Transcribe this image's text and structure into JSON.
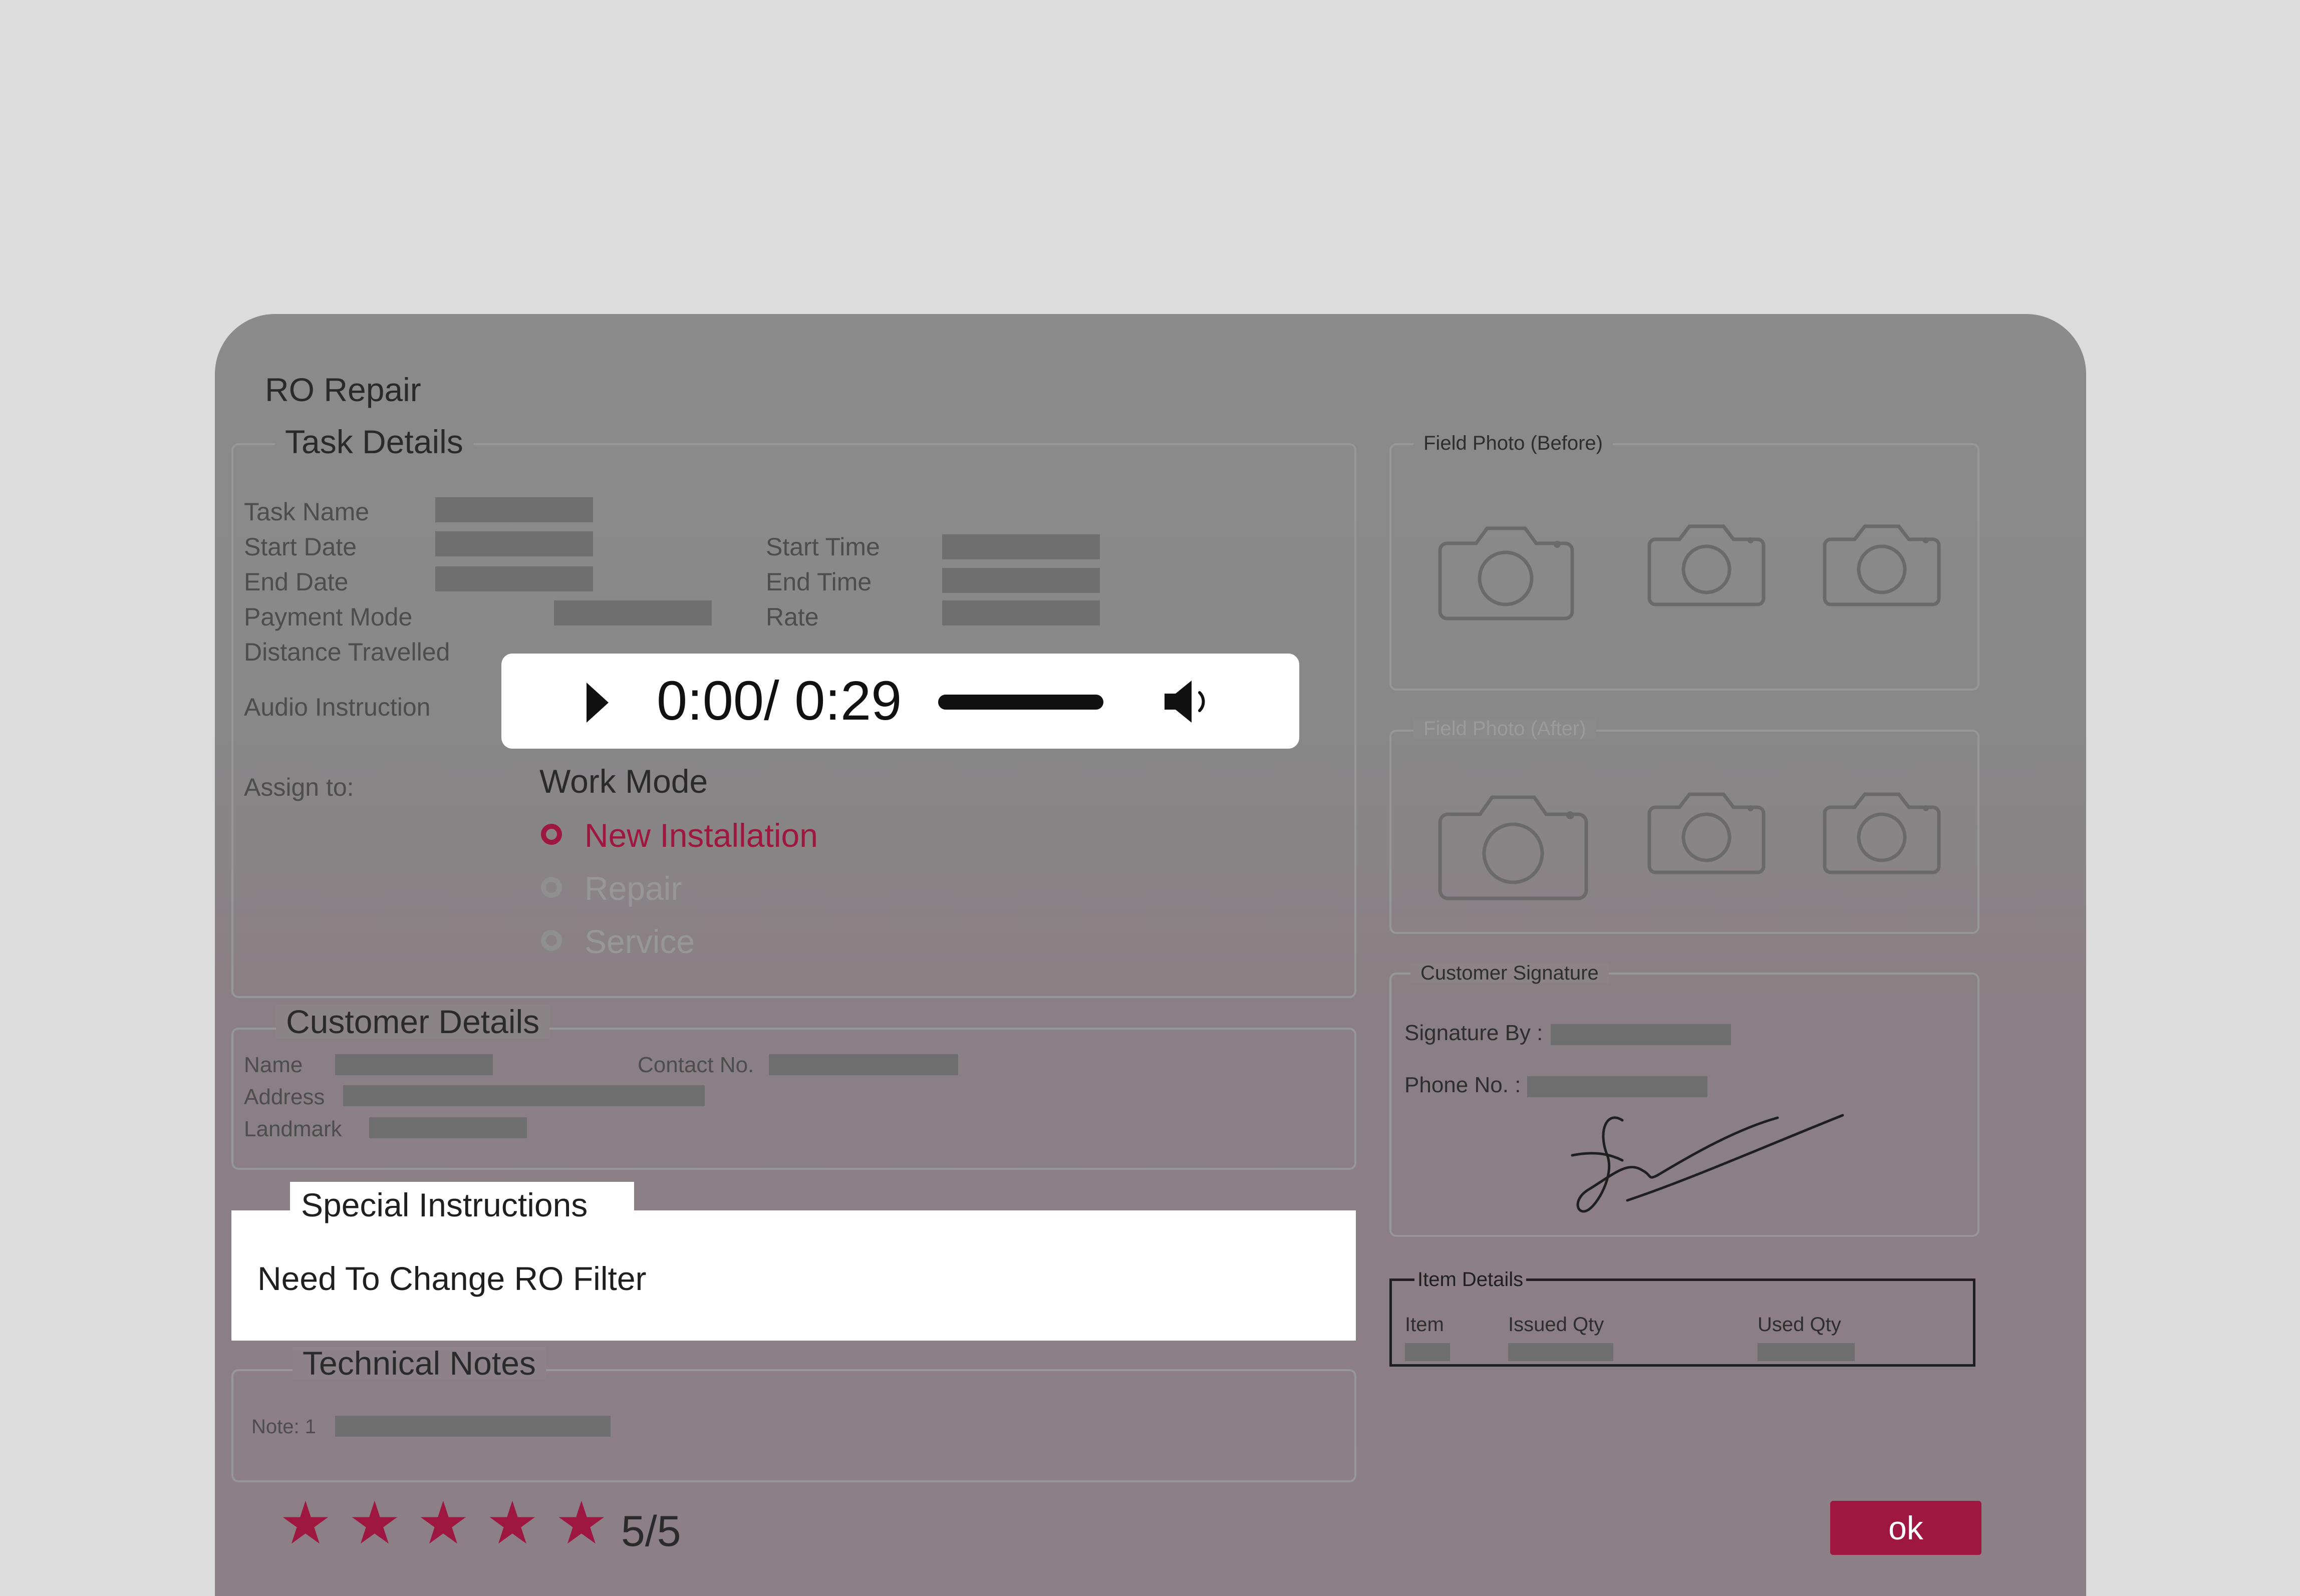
{
  "page": {
    "title": "RO Repair"
  },
  "task_details": {
    "legend": "Task Details",
    "task_name": "Task Name",
    "start_date": "Start Date",
    "end_date": "End Date",
    "payment_mode": "Payment Mode",
    "distance_travelled": "Distance Travelled",
    "start_time": "Start Time",
    "end_time": "End Time",
    "rate": "Rate",
    "audio_instruction": "Audio Instruction",
    "assign_to": "Assign to:"
  },
  "audio_player": {
    "time": "0:00/ 0:29",
    "play_icon": "play-icon",
    "volume_icon": "volume-icon"
  },
  "work_mode": {
    "label": "Work Mode",
    "options": [
      "New Installation",
      "Repair",
      "Service"
    ],
    "selected": "New Installation"
  },
  "customer_details": {
    "legend": "Customer Details",
    "name": "Name",
    "address": "Address",
    "landmark": "Landmark",
    "contact": "Contact No."
  },
  "special_instructions": {
    "legend": "Special Instructions",
    "text": "Need To Change RO Filter"
  },
  "technical_notes": {
    "legend": "Technical Notes",
    "note": "Note: 1"
  },
  "rating": {
    "stars": 5,
    "label": "5/5"
  },
  "photos": {
    "before_legend": "Field Photo (Before)",
    "after_legend": "Field Photo (After)"
  },
  "signature": {
    "legend": "Customer Signature",
    "by": "Signature By :",
    "phone": "Phone No. :"
  },
  "item_details": {
    "legend": "Item Details",
    "columns": [
      "Item",
      "Issued Qty",
      "Used Qty"
    ]
  },
  "actions": {
    "ok": "ok"
  },
  "colors": {
    "accent": "#9d1740",
    "background": "#dcdcdc"
  }
}
